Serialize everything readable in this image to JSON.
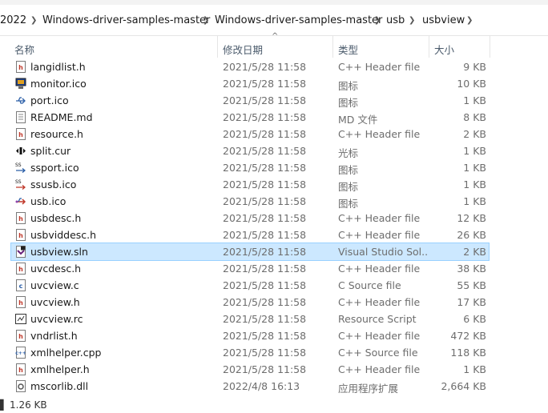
{
  "breadcrumb": [
    "2022",
    "Windows-driver-samples-master",
    "Windows-driver-samples-master",
    "usb",
    "usbview"
  ],
  "columns": {
    "name": "名称",
    "date": "修改日期",
    "type": "类型",
    "size": "大小"
  },
  "files": [
    {
      "name": "langidlist.h",
      "date": "2021/5/28 11:58",
      "type": "C++ Header file",
      "size": "9 KB",
      "icon": "h-file-icon"
    },
    {
      "name": "monitor.ico",
      "date": "2021/5/28 11:58",
      "type": "图标",
      "size": "10 KB",
      "icon": "monitor-icon"
    },
    {
      "name": "port.ico",
      "date": "2021/5/28 11:58",
      "type": "图标",
      "size": "1 KB",
      "icon": "usb-port-icon"
    },
    {
      "name": "README.md",
      "date": "2021/5/28 11:58",
      "type": "MD 文件",
      "size": "8 KB",
      "icon": "md-file-icon"
    },
    {
      "name": "resource.h",
      "date": "2021/5/28 11:58",
      "type": "C++ Header file",
      "size": "2 KB",
      "icon": "h-file-icon"
    },
    {
      "name": "split.cur",
      "date": "2021/5/28 11:58",
      "type": "光标",
      "size": "1 KB",
      "icon": "split-cursor-icon"
    },
    {
      "name": "ssport.ico",
      "date": "2021/5/28 11:58",
      "type": "图标",
      "size": "1 KB",
      "icon": "ssport-icon"
    },
    {
      "name": "ssusb.ico",
      "date": "2021/5/28 11:58",
      "type": "图标",
      "size": "1 KB",
      "icon": "ssusb-icon"
    },
    {
      "name": "usb.ico",
      "date": "2021/5/28 11:58",
      "type": "图标",
      "size": "1 KB",
      "icon": "usb-icon"
    },
    {
      "name": "usbdesc.h",
      "date": "2021/5/28 11:58",
      "type": "C++ Header file",
      "size": "12 KB",
      "icon": "h-file-icon"
    },
    {
      "name": "usbviddesc.h",
      "date": "2021/5/28 11:58",
      "type": "C++ Header file",
      "size": "26 KB",
      "icon": "h-file-icon"
    },
    {
      "name": "usbview.sln",
      "date": "2021/5/28 11:58",
      "type": "Visual Studio Sol...",
      "size": "2 KB",
      "icon": "visual-studio-sln-icon",
      "selected": true
    },
    {
      "name": "uvcdesc.h",
      "date": "2021/5/28 11:58",
      "type": "C++ Header file",
      "size": "38 KB",
      "icon": "h-file-icon"
    },
    {
      "name": "uvcview.c",
      "date": "2021/5/28 11:58",
      "type": "C Source file",
      "size": "55 KB",
      "icon": "c-file-icon"
    },
    {
      "name": "uvcview.h",
      "date": "2021/5/28 11:58",
      "type": "C++ Header file",
      "size": "17 KB",
      "icon": "h-file-icon"
    },
    {
      "name": "uvcview.rc",
      "date": "2021/5/28 11:58",
      "type": "Resource Script",
      "size": "6 KB",
      "icon": "rc-file-icon"
    },
    {
      "name": "vndrlist.h",
      "date": "2021/5/28 11:58",
      "type": "C++ Header file",
      "size": "472 KB",
      "icon": "h-file-icon"
    },
    {
      "name": "xmlhelper.cpp",
      "date": "2021/5/28 11:58",
      "type": "C++ Source file",
      "size": "118 KB",
      "icon": "cpp-file-icon"
    },
    {
      "name": "xmlhelper.h",
      "date": "2021/5/28 11:58",
      "type": "C++ Header file",
      "size": "1 KB",
      "icon": "h-file-icon"
    },
    {
      "name": "mscorlib.dll",
      "date": "2022/4/8 16:13",
      "type": "应用程序扩展",
      "size": "2,664 KB",
      "icon": "dll-file-icon"
    }
  ],
  "status": {
    "selection_size": "1.26 KB"
  },
  "colors": {
    "selection_bg": "#cce8ff",
    "selection_border": "#99d1ff",
    "header_text": "#4a5a6b",
    "detail_text": "#6d6d6d"
  }
}
